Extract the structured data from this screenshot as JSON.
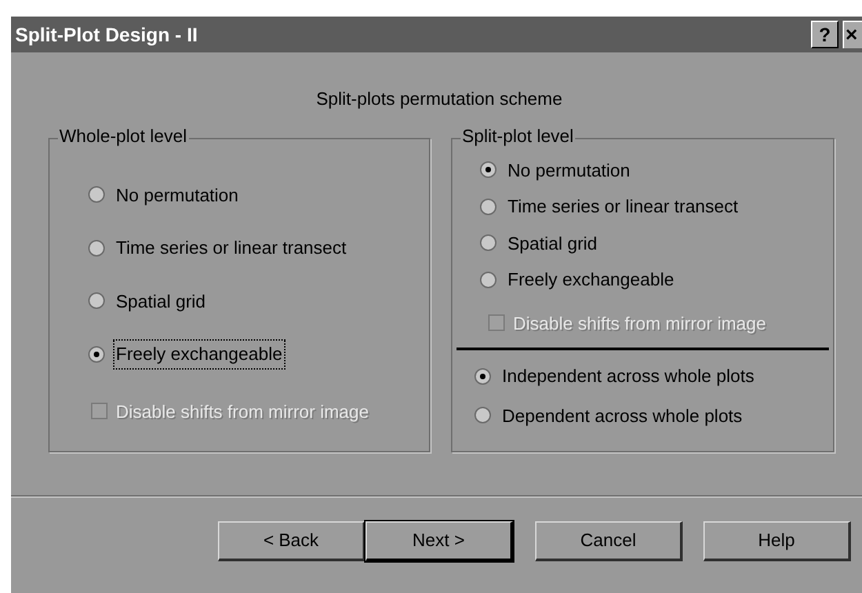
{
  "window": {
    "title": "Split-Plot Design - II",
    "help_button": "?",
    "close_button": "×"
  },
  "heading": "Split-plots permutation scheme",
  "whole_plot": {
    "title": "Whole-plot level",
    "options": [
      {
        "label": "No permutation",
        "selected": false,
        "focused": false
      },
      {
        "label": "Time series or linear transect",
        "selected": false,
        "focused": false
      },
      {
        "label": "Spatial grid",
        "selected": false,
        "focused": false
      },
      {
        "label": "Freely exchangeable",
        "selected": true,
        "focused": true
      }
    ],
    "mirror_checkbox": {
      "label": "Disable shifts from mirror image",
      "checked": false,
      "disabled": true
    }
  },
  "split_plot": {
    "title": "Split-plot level",
    "options": [
      {
        "label": "No permutation",
        "selected": true
      },
      {
        "label": "Time series or linear transect",
        "selected": false
      },
      {
        "label": "Spatial grid",
        "selected": false
      },
      {
        "label": "Freely exchangeable",
        "selected": false
      }
    ],
    "mirror_checkbox": {
      "label": "Disable shifts from mirror image",
      "checked": false,
      "disabled": true
    },
    "dependence_options": [
      {
        "label": "Independent across whole plots",
        "selected": true
      },
      {
        "label": "Dependent across whole plots",
        "selected": false
      }
    ]
  },
  "buttons": [
    {
      "label": "< Back",
      "default": false
    },
    {
      "label": "Next >",
      "default": true
    },
    {
      "label": "Cancel",
      "default": false
    },
    {
      "label": "Help",
      "default": false
    }
  ]
}
